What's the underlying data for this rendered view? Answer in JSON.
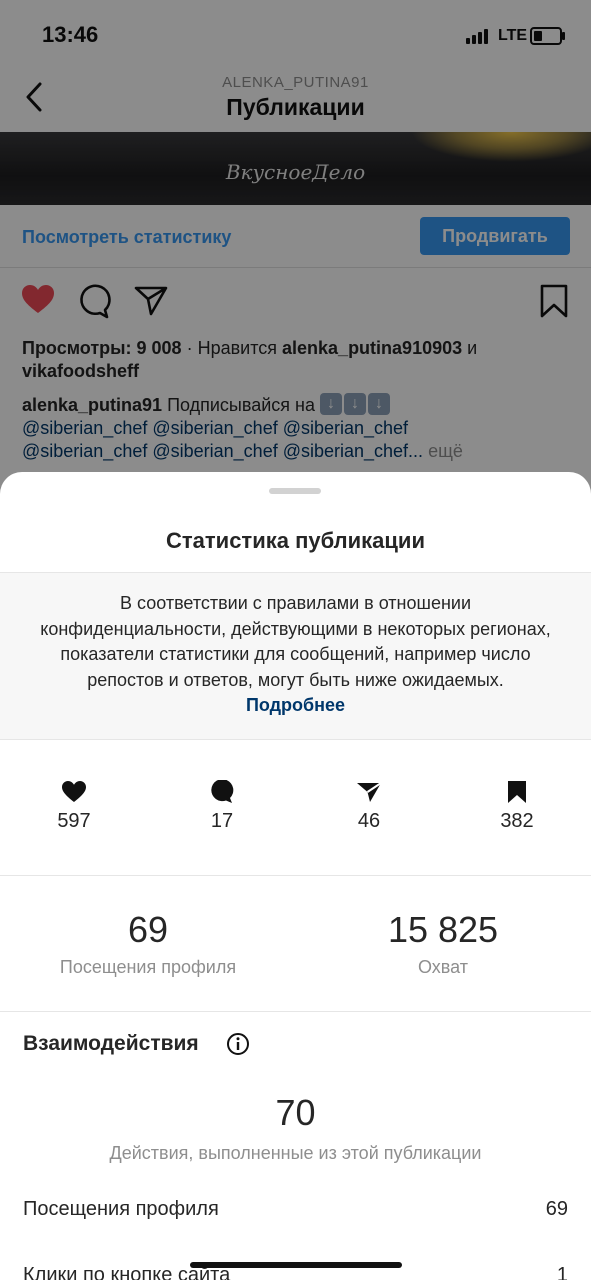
{
  "status_bar": {
    "time": "13:46",
    "network": "LTE"
  },
  "nav": {
    "username": "ALENKA_PUTINA91",
    "title": "Публикации"
  },
  "post_image": {
    "brand_text": "ВкусноеДело"
  },
  "post_stats_bar": {
    "stats_link": "Посмотреть статистику",
    "promote_button": "Продвигать"
  },
  "post": {
    "views_label": "Просмотры: 9 008",
    "likes_prefix": "· Нравится",
    "liked_by_1": "alenka_putina910903",
    "likes_and": "и",
    "liked_by_2": "vikafoodsheff",
    "author": "alenka_putina91",
    "caption_text": "Подписывайся на",
    "mention": "@siberian_chef",
    "mention_cut": "@siberian_chef...",
    "more": "ещё"
  },
  "sheet": {
    "title": "Статистика публикации",
    "notice_text": "В соответствии с правилами в отношении конфиденциальности, действующими в некоторых регионах, показатели статистики для сообщений, например число репостов и ответов, могут быть ниже ожидаемых.",
    "notice_link": "Подробнее",
    "counts": {
      "likes": "597",
      "comments": "17",
      "shares": "46",
      "saves": "382"
    },
    "profile_visits_value": "69",
    "profile_visits_label": "Посещения профиля",
    "reach_value": "15 825",
    "reach_label": "Охват",
    "interactions_title": "Взаимодействия",
    "interactions_total": "70",
    "interactions_desc": "Действия, выполненные из этой публикации",
    "rows": [
      {
        "label": "Посещения профиля",
        "value": "69"
      },
      {
        "label": "Клики по кнопке сайта",
        "value": "1"
      }
    ]
  },
  "colors": {
    "link_blue": "#3897f0",
    "mention_blue": "#00376b",
    "like_red": "#ed4956",
    "overlay": "rgba(0,0,0,0.45)"
  }
}
